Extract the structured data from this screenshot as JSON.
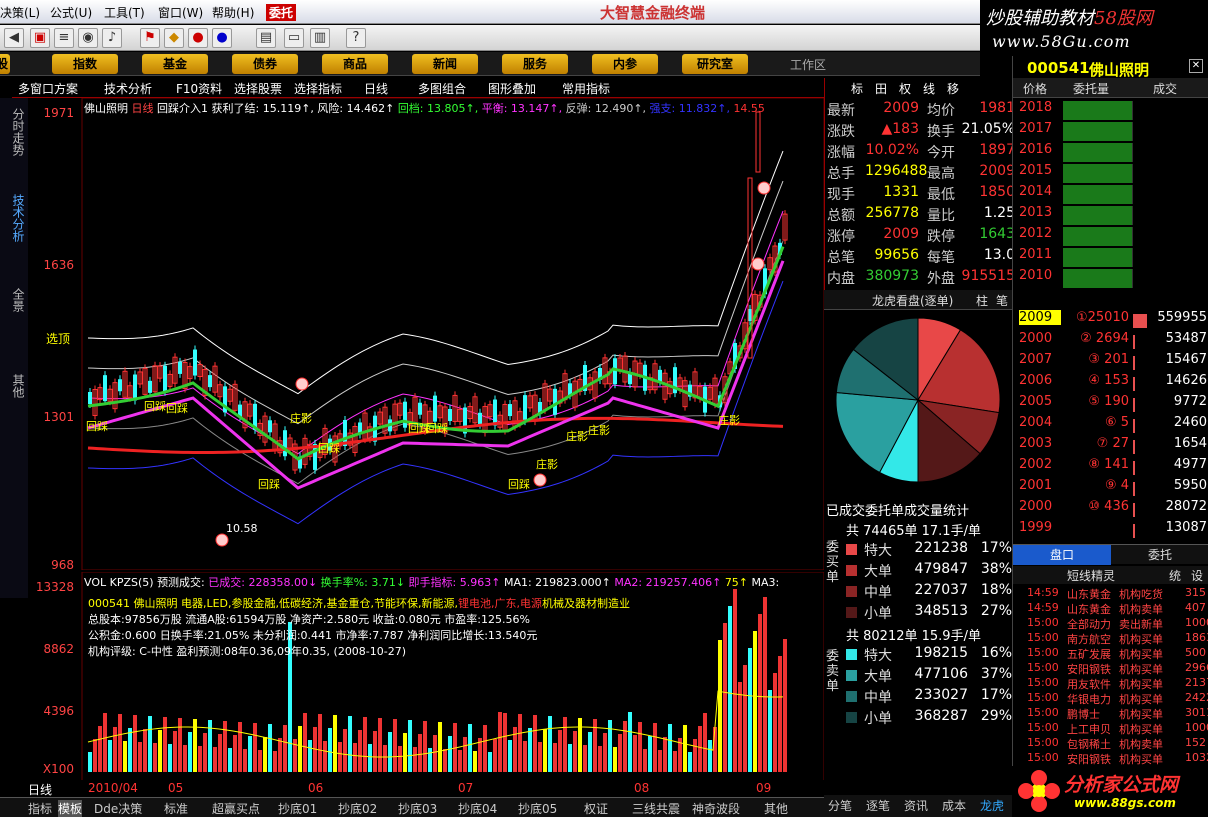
{
  "menu": {
    "items": [
      "决策(L)",
      "公式(U)",
      "工具(T)",
      "窗口(W)",
      "帮助(H)",
      "委托"
    ],
    "app_title": "大智慧金融终端"
  },
  "brand": {
    "line1a": "炒股辅助教材",
    "line1b": "58股网",
    "line2": "www.58Gu.com"
  },
  "nav": {
    "items": [
      "股",
      "指数",
      "基金",
      "债券",
      "商品",
      "新闻",
      "服务",
      "内参",
      "研究室"
    ],
    "right": "工作区"
  },
  "chartbar": {
    "items": [
      "多窗口方案",
      "技术分析",
      "F10资料",
      "选择股票",
      "选择指标",
      "日线",
      "多图组合",
      "图形叠加",
      "常用指标"
    ]
  },
  "vtabs": [
    "分时走势",
    "技术分析",
    "全景",
    "其他"
  ],
  "main": {
    "legend": [
      {
        "text": "佛山照明",
        "color": "#fff"
      },
      {
        "text": "日线",
        "color": "#f44"
      },
      {
        "text": "回踩介入1",
        "color": "#fff"
      },
      {
        "text": "获利了结: 15.119↑,",
        "color": "#fff"
      },
      {
        "text": "风险: 14.462↑",
        "color": "#fff"
      },
      {
        "text": "回档: 13.805↑,",
        "color": "#3f3"
      },
      {
        "text": "平衡: 13.147↑,",
        "color": "#f3f"
      },
      {
        "text": "反弹: 12.490↑,",
        "color": "#ccc"
      },
      {
        "text": "强支: 11.832↑,",
        "color": "#33f"
      },
      {
        "text": "14.55",
        "color": "#f33"
      }
    ],
    "y_labels": [
      "1971",
      "1636",
      "1301",
      "968"
    ],
    "xuanding": "选顶",
    "low_label": "10.58",
    "annotations": [
      "回踩",
      "回踩",
      "回踩",
      "回踩",
      "回踩",
      "回踩",
      "回踩",
      "回踩",
      "庄影",
      "庄影",
      "庄影",
      "庄影",
      "庄影"
    ]
  },
  "vol": {
    "legend": [
      {
        "text": "VOL KPZS(5)",
        "color": "#fff"
      },
      {
        "text": "预测成交:",
        "color": "#fff"
      },
      {
        "text": "已成交: 228358.00↓",
        "color": "#f3f"
      },
      {
        "text": "换手率%: 3.71↓",
        "color": "#3f3"
      },
      {
        "text": "即手指标: 5.963↑",
        "color": "#f3f"
      },
      {
        "text": "MA1: 219823.000↑",
        "color": "#fff"
      },
      {
        "text": "MA2: 219257.406↑",
        "color": "#f3f"
      },
      {
        "text": "75↑",
        "color": "#ff0"
      },
      {
        "text": "MA3:",
        "color": "#fff"
      }
    ],
    "y_labels": [
      "13328",
      "8862",
      "4396",
      "X100"
    ],
    "info": {
      "line1a": "000541 佛山照明 电器,LED,参股金融,低碳经济,基金重仓,节能环保,新能源,",
      "line1b": "锂电池,广东,电源",
      "line1c": "机械及器材制造业",
      "line2": "总股本:97856万股 流通A股:61594万股 净资产:2.580元 收益:0.080元 市盈率:125.56%",
      "line3": "公积金:0.600 日换手率:21.05% 未分利润:0.441 市净率:7.787 净利润同比增长:13.540元",
      "line4": "机构评级: C-中性 盈利预测:08年0.36,09年0.35, (2008-10-27)"
    }
  },
  "dates": [
    "日线",
    "2010/04",
    "05",
    "06",
    "07",
    "08",
    "09"
  ],
  "bottom_tabs": [
    "指标",
    "模板",
    "Dde决策",
    "标准",
    "超赢买点",
    "抄底01",
    "抄底02",
    "抄底03",
    "抄底04",
    "抄底05",
    "权证",
    "三线共震",
    "神奇波段",
    "其他"
  ],
  "quote": {
    "tabs": [
      "标",
      "田",
      "权",
      "线",
      "移"
    ],
    "rows": [
      {
        "k": "最新",
        "v": "2009",
        "vc": "up",
        "k2": "均价",
        "v2": "1981",
        "v2c": "up"
      },
      {
        "k": "涨跌",
        "v": "▲183",
        "vc": "up",
        "k2": "换手",
        "v2": "21.05%",
        "v2c": "wh"
      },
      {
        "k": "涨幅",
        "v": "10.02%",
        "vc": "up",
        "k2": "今开",
        "v2": "1897",
        "v2c": "up"
      },
      {
        "k": "总手",
        "v": "1296488",
        "vc": "yel",
        "k2": "最高",
        "v2": "2009",
        "v2c": "up"
      },
      {
        "k": "现手",
        "v": "1331",
        "vc": "yel",
        "k2": "最低",
        "v2": "1850",
        "v2c": "up"
      },
      {
        "k": "总额",
        "v": "256778",
        "vc": "yel",
        "k2": "量比",
        "v2": "1.25",
        "v2c": "wh"
      },
      {
        "k": "涨停",
        "v": "2009",
        "vc": "up",
        "k2": "跌停",
        "v2": "1643",
        "v2c": "dn"
      },
      {
        "k": "总笔",
        "v": "99656",
        "vc": "yel",
        "k2": "每笔",
        "v2": "13.0",
        "v2c": "wh"
      },
      {
        "k": "内盘",
        "v": "380973",
        "vc": "dn",
        "k2": "外盘",
        "v2": "915515",
        "v2c": "up"
      }
    ]
  },
  "pie": {
    "title": "龙虎看盘(逐单)",
    "tabs": [
      "柱",
      "笔"
    ],
    "caption": "已成交委托单成交量统计",
    "slices": [
      {
        "v": 221238,
        "c": "#e84848"
      },
      {
        "v": 479847,
        "c": "#b83030"
      },
      {
        "v": 227037,
        "c": "#8a2424"
      },
      {
        "v": 348513,
        "c": "#541818"
      },
      {
        "v": 198215,
        "c": "#33e8e8"
      },
      {
        "v": 477106,
        "c": "#2aa0a0"
      },
      {
        "v": 233027,
        "c": "#1f7070"
      },
      {
        "v": 368287,
        "c": "#164444"
      }
    ]
  },
  "buy": {
    "label": "委买单",
    "total": "共 74465单 17.1手/单",
    "rows": [
      {
        "k": "特大",
        "v": "221238",
        "p": "17%",
        "c": "#e84848"
      },
      {
        "k": "大单",
        "v": "479847",
        "p": "38%",
        "c": "#b83030"
      },
      {
        "k": "中单",
        "v": "227037",
        "p": "18%",
        "c": "#8a2424"
      },
      {
        "k": "小单",
        "v": "348513",
        "p": "27%",
        "c": "#541818"
      }
    ]
  },
  "sell": {
    "label": "委卖单",
    "total": "共 80212单 15.9手/单",
    "rows": [
      {
        "k": "特大",
        "v": "198215",
        "p": "16%",
        "c": "#33e8e8"
      },
      {
        "k": "大单",
        "v": "477106",
        "p": "37%",
        "c": "#2aa0a0"
      },
      {
        "k": "中单",
        "v": "233027",
        "p": "17%",
        "c": "#1f7070"
      },
      {
        "k": "小单",
        "v": "368287",
        "p": "29%",
        "c": "#164444"
      }
    ]
  },
  "rtabs": [
    "分笔",
    "逐笔",
    "资讯",
    "成本",
    "龙虎"
  ],
  "order": {
    "code": "000541",
    "name": "佛山照明",
    "cols": [
      "价格",
      "委托量",
      "成交"
    ],
    "sell": [
      "2018",
      "2017",
      "2016",
      "2015",
      "2014",
      "2013",
      "2012",
      "2011",
      "2010"
    ],
    "buy": [
      {
        "p": "2009",
        "q": "①25010",
        "t": "559955",
        "bar": 1.0
      },
      {
        "p": "2000",
        "q": "② 2694",
        "t": "53487",
        "bar": 0.1
      },
      {
        "p": "2007",
        "q": "③ 201",
        "t": "15467",
        "bar": 0.03
      },
      {
        "p": "2006",
        "q": "④ 153",
        "t": "14626",
        "bar": 0.03
      },
      {
        "p": "2005",
        "q": "⑤ 190",
        "t": "9772",
        "bar": 0.02
      },
      {
        "p": "2004",
        "q": "⑥ 5",
        "t": "2460",
        "bar": 0.01
      },
      {
        "p": "2003",
        "q": "⑦ 27",
        "t": "1654",
        "bar": 0.01
      },
      {
        "p": "2002",
        "q": "⑧ 141",
        "t": "4977",
        "bar": 0.01
      },
      {
        "p": "2001",
        "q": "⑨ 4",
        "t": "5950",
        "bar": 0.01
      },
      {
        "p": "2000",
        "q": "⑩ 436",
        "t": "28072",
        "bar": 0.05
      },
      {
        "p": "1999",
        "q": "",
        "t": "13087",
        "bar": 0.03
      }
    ],
    "tabs": [
      "盘口",
      "委托"
    ]
  },
  "spirit": {
    "title": "短线精灵",
    "tabs": [
      "统",
      "设"
    ],
    "rows": [
      {
        "t": "14:59",
        "s": "山东黄金",
        "e": "机构吃货",
        "n": "315"
      },
      {
        "t": "14:59",
        "s": "山东黄金",
        "e": "机构卖单",
        "n": "407"
      },
      {
        "t": "15:00",
        "s": "全部动力",
        "e": "卖出新单",
        "n": "10000"
      },
      {
        "t": "15:00",
        "s": "南方航空",
        "e": "机构买单",
        "n": "1863"
      },
      {
        "t": "15:00",
        "s": "五矿发展",
        "e": "机构买单",
        "n": "500"
      },
      {
        "t": "15:00",
        "s": "安阳钢铁",
        "e": "机构买单",
        "n": "2966"
      },
      {
        "t": "15:00",
        "s": "用友软件",
        "e": "机构买单",
        "n": "2137"
      },
      {
        "t": "15:00",
        "s": "华银电力",
        "e": "机构买单",
        "n": "2422"
      },
      {
        "t": "15:00",
        "s": "鹏博士",
        "e": "机构买单",
        "n": "3011"
      },
      {
        "t": "15:00",
        "s": "上工申贝",
        "e": "机构买单",
        "n": "1000"
      },
      {
        "t": "15:00",
        "s": "包钢稀土",
        "e": "机构卖单",
        "n": "152"
      },
      {
        "t": "15:00",
        "s": "安阳钢铁",
        "e": "机构买单",
        "n": "1032"
      }
    ]
  },
  "logo2": {
    "text": "分析家公式网",
    "url": "www.88gs.com"
  }
}
